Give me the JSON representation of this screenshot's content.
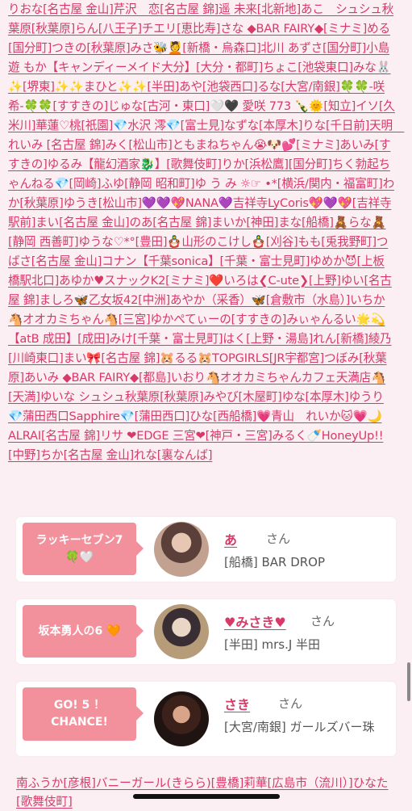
{
  "links_text": "りおな[名古屋 金山]芹沢　恋[名古屋 錦]遥 未来[北新地]あこ　シュシュ秋葉原[秋葉原]らん[八王子]チエリ[恵比寿]さな ◆BAR FAIRY◆[ミナミ]める[国分町]つきの[秋葉原]みさ🐝💆[新橋・烏森口]北川 あずさ[国分町]小島遊 もか【キャンディーメイド大分】[大分・都町]ちょこ[池袋東口]みな🐰✨[堺東]✨✨まひと✨✨[半田]あや[池袋西口]るな[大宮/南銀]🍀🍀-咲希-🍀🍀[すすきの]じゅな[古河・東口]🤍🖤 愛咲 773 🍾🌞[知立]イソ[久米川]華蓮♡桃[祇園]💎水沢 澪💎[富士見]なずな[本厚木]りな[千日前]天明　れいみ [名古屋 錦]みく[松山市]ともまねちゃん😭🐶💕[ミナミ]あいみ[すすきの]ゆるみ【龍幻酒家🐉】[歌舞伎町]りか[浜松鷹][国分町]ちく勃起ちゃんねる💎[岡崎]ふゆ[静岡 昭和町]ゆ う み ☼☞ •*[横浜/関内・福富町]わか[秋葉原]ゆうき[松山市]💜💜💖NANA💜吉祥寺LyCoris💖💜💖[吉祥寺駅前]まい[名古屋 金山]のあ[名古屋 錦]まいか[神田]まな[船橋]🧸らな🧸[静岡 西善町]ゆうな♡*°[豊田]🪆山形のこけし🪆[刈谷]もも[兎我野町]つばさ[名古屋 金山]コナン【千葉sonica】[千葉・富士見町]ゆめか😈[上板橋駅北口]あゆか♥スナックK2[ミナミ]❤️いろは❮C-ute❯[上野]ゆい[名古屋 錦]ましろ🦋乙女坂42[中洲]あやか（采香）🦋[倉敷市（水島）]いちか🐴オオカミちゃん🐴[三宮]ゆかぺてぃーの[すすきの]みぃゃんるい🌟💫【atB 成田】[成田]みけ[千葉・富士見町]はく[上野・湯島]れん[新橋]綾乃[川崎東口]まい🎀[名古屋 錦]🐹るる🐹TOPGIRLS[JR宇都宮]つぼみ[秋葉原]あいみ ◆BAR FAIRY◆[都島]いおり🐴オオカミちゃんカフェ天満店🐴[天満]ゆいな シュシュ秋葉原[秋葉原]みやび[木屋町]ゆな[本厚木]ゆうり💎蒲田西口Sapphire💎[蒲田西口]ひな[西船橋]💗青山　れいか🐱💗🌙ALRAI[名古屋 錦]リサ ❤EDGE 三宮❤[神戸・三宮]みるく🍼HoneyUp!![中野]ちか[名古屋 金山]れな[裏なんば]",
  "ranking": [
    {
      "badge": "ラッキーセブン7\n🍀🤍",
      "name": "あ",
      "honorific": "さん",
      "shop": "[船橋] BAR DROP"
    },
    {
      "badge": "坂本勇人の6 🧡",
      "name": "♥みさき♥",
      "honorific": "さん",
      "shop": "[半田] mrs.J 半田"
    },
    {
      "badge": "GO! 5 ！\nCHANCE!",
      "name": "さき",
      "honorific": "さん",
      "shop": "[大宮/南銀] ガールズバー珠"
    }
  ],
  "bottom_links_text": "南ふうか[彦根]バニーガール(きらら)[豊橋]莉華[広島市（流川）]ひなた[歌舞伎町]"
}
